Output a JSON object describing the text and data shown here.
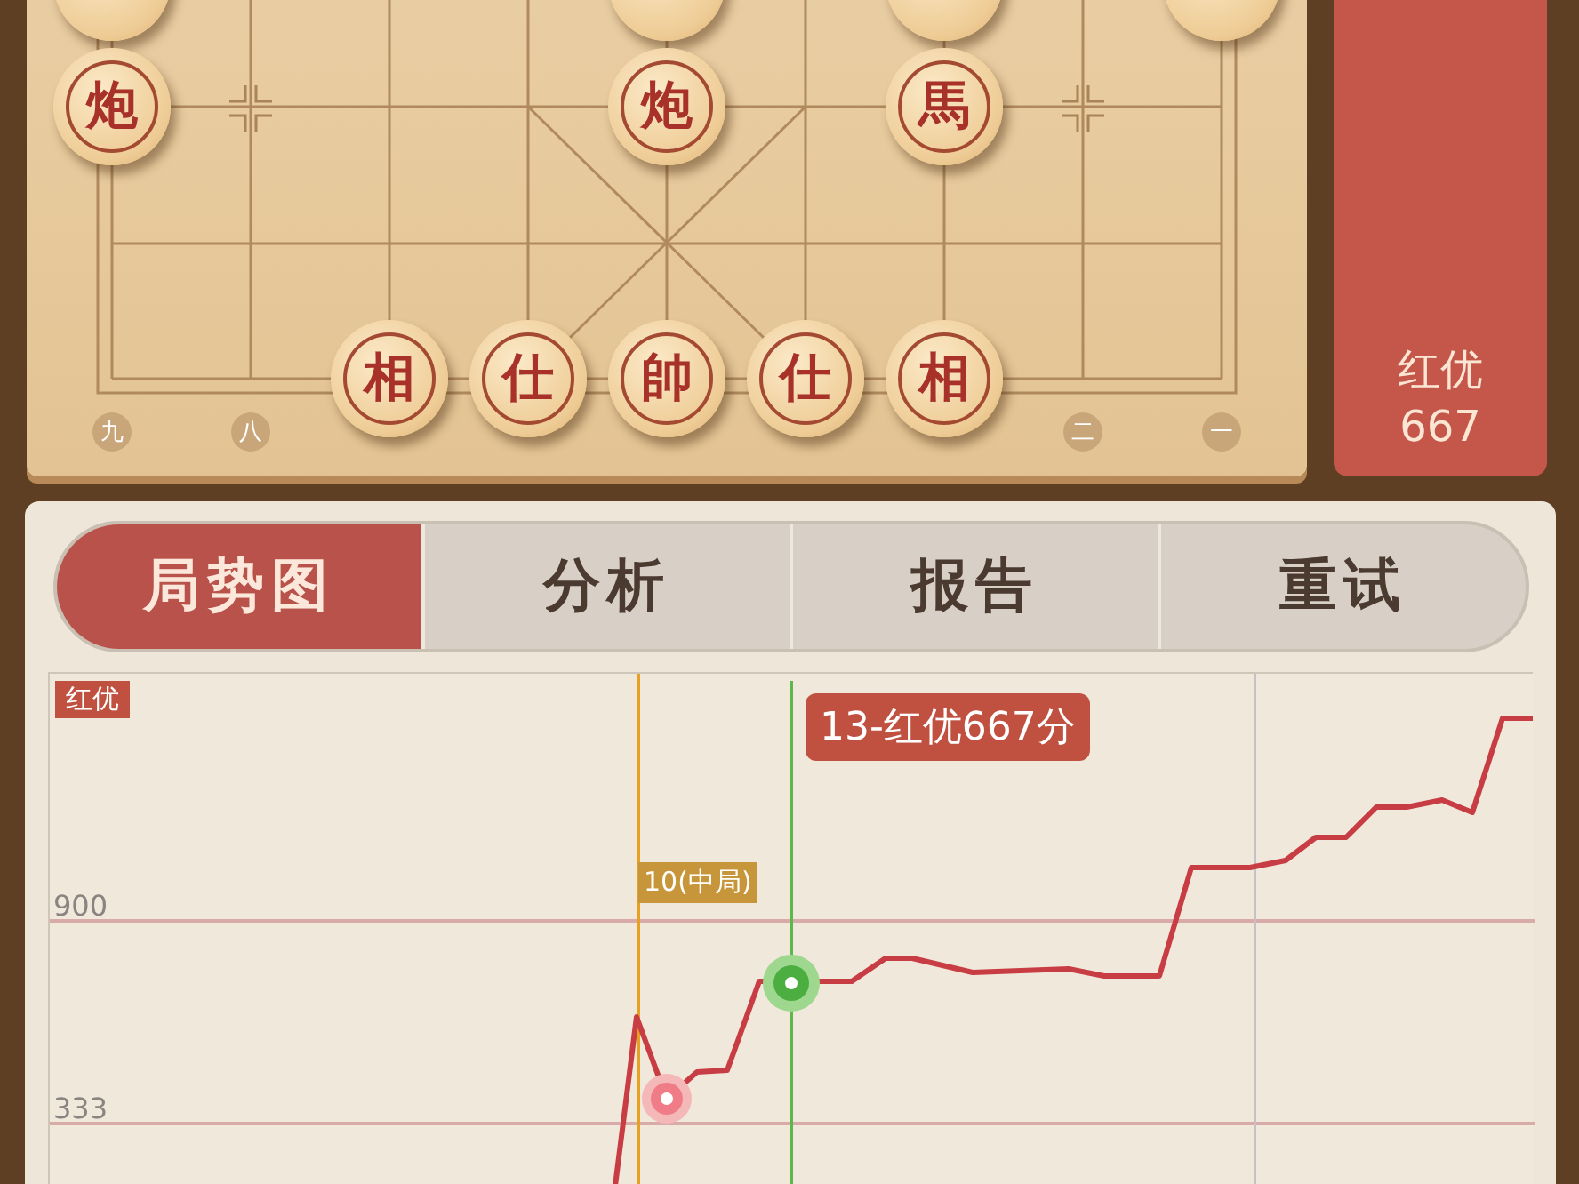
{
  "board": {
    "pieces": [
      {
        "kind": "cut"
      },
      {
        "kind": "cut"
      },
      {
        "kind": "cut"
      },
      {
        "kind": "cut"
      },
      {
        "kind": "full",
        "label": "炮"
      },
      {
        "kind": "full",
        "label": "炮"
      },
      {
        "kind": "full",
        "label": "馬"
      },
      {
        "kind": "full",
        "label": "相"
      },
      {
        "kind": "full",
        "label": "仕"
      },
      {
        "kind": "full",
        "label": "帥"
      },
      {
        "kind": "full",
        "label": "仕"
      },
      {
        "kind": "full",
        "label": "相"
      }
    ],
    "file_labels": [
      "九",
      "八",
      "二",
      "一"
    ]
  },
  "advantage_bar": {
    "side": "红优",
    "score": "667"
  },
  "tabs": [
    {
      "label": "局势图",
      "selected": true
    },
    {
      "label": "分析",
      "selected": false
    },
    {
      "label": "报告",
      "selected": false
    },
    {
      "label": "重试",
      "selected": false
    }
  ],
  "chart": {
    "side_tag": "红优",
    "ticks": [
      "900",
      "333"
    ],
    "phase_marker": "10(中局)",
    "tooltip": "13-红优667分"
  }
}
